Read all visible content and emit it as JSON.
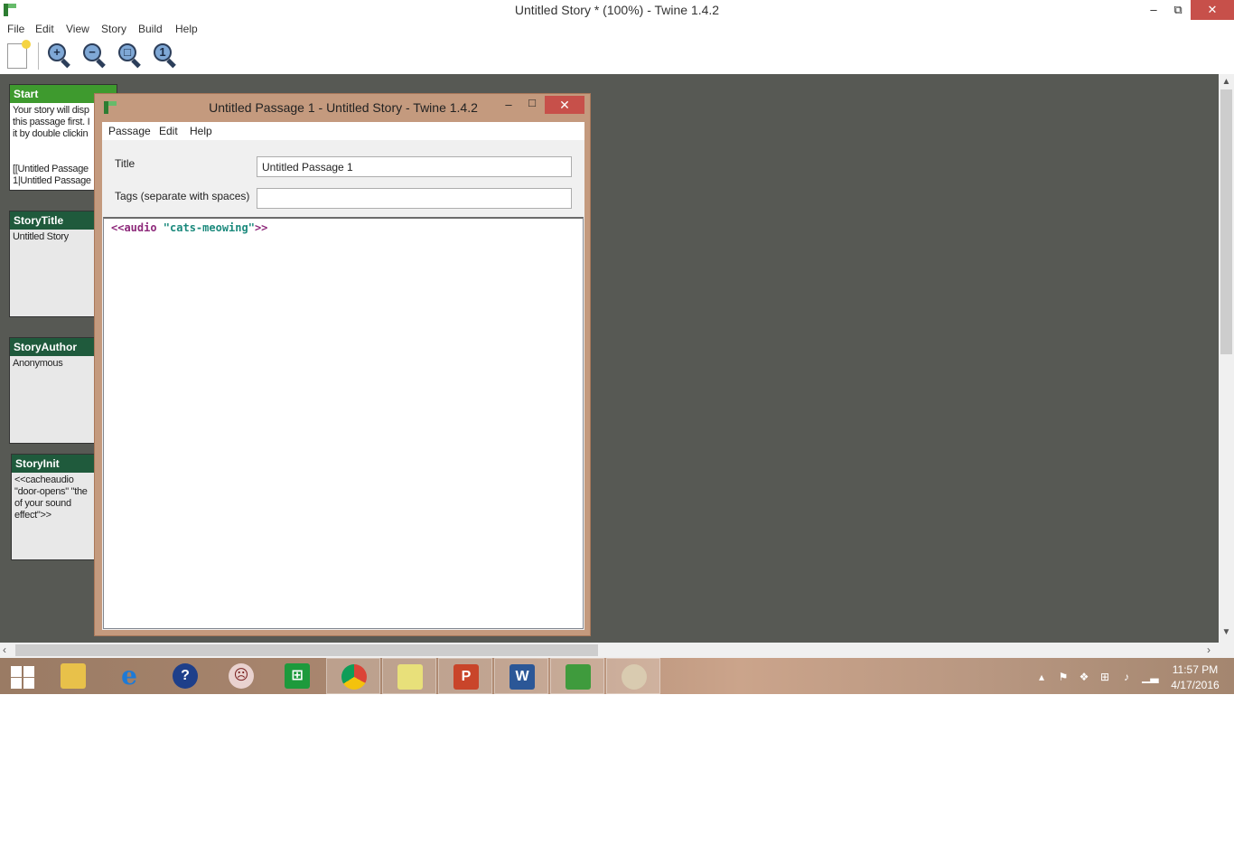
{
  "app": {
    "title": "Untitled Story * (100%) - Twine 1.4.2",
    "menu": [
      "File",
      "Edit",
      "View",
      "Story",
      "Build",
      "Help"
    ],
    "toolbar_icons": [
      "new-passage-icon",
      "zoom-in-icon",
      "zoom-out-icon",
      "zoom-fit-icon",
      "zoom-100-icon"
    ]
  },
  "passages": [
    {
      "title": "Start",
      "text": "Your story will disp\nthis passage first. I\nit by double clickin\n\n\n[[Untitled Passage\n1|Untitled Passage",
      "header_color": "#3e9a2e"
    },
    {
      "title": "StoryTitle",
      "text": "Untitled Story",
      "header_color": "#1f5a3c"
    },
    {
      "title": "StoryAuthor",
      "text": "Anonymous",
      "header_color": "#1f5a3c"
    },
    {
      "title": "StoryInit",
      "text": "<<cacheaudio\n\"door-opens\" \"the\nof your sound\neffect\">>",
      "header_color": "#1f5a3c"
    }
  ],
  "editor": {
    "title": "Untitled Passage 1 - Untitled Story - Twine 1.4.2",
    "menu": [
      "Passage",
      "Edit",
      "Help"
    ],
    "title_label": "Title",
    "title_value": "Untitled Passage 1",
    "tags_label": "Tags (separate with spaces)",
    "tags_value": "",
    "body_macro_open": "<<audio ",
    "body_string": "\"cats-meowing\"",
    "body_macro_close": ">>"
  },
  "taskbar": {
    "apps": [
      "file-explorer-icon",
      "internet-explorer-icon",
      "help-app-icon",
      "game-character-icon",
      "store-icon",
      "chrome-icon",
      "sticky-notes-icon",
      "powerpoint-icon",
      "word-icon",
      "twine-icon",
      "paint-icon"
    ],
    "time": "11:57 PM",
    "date": "4/17/2016"
  }
}
